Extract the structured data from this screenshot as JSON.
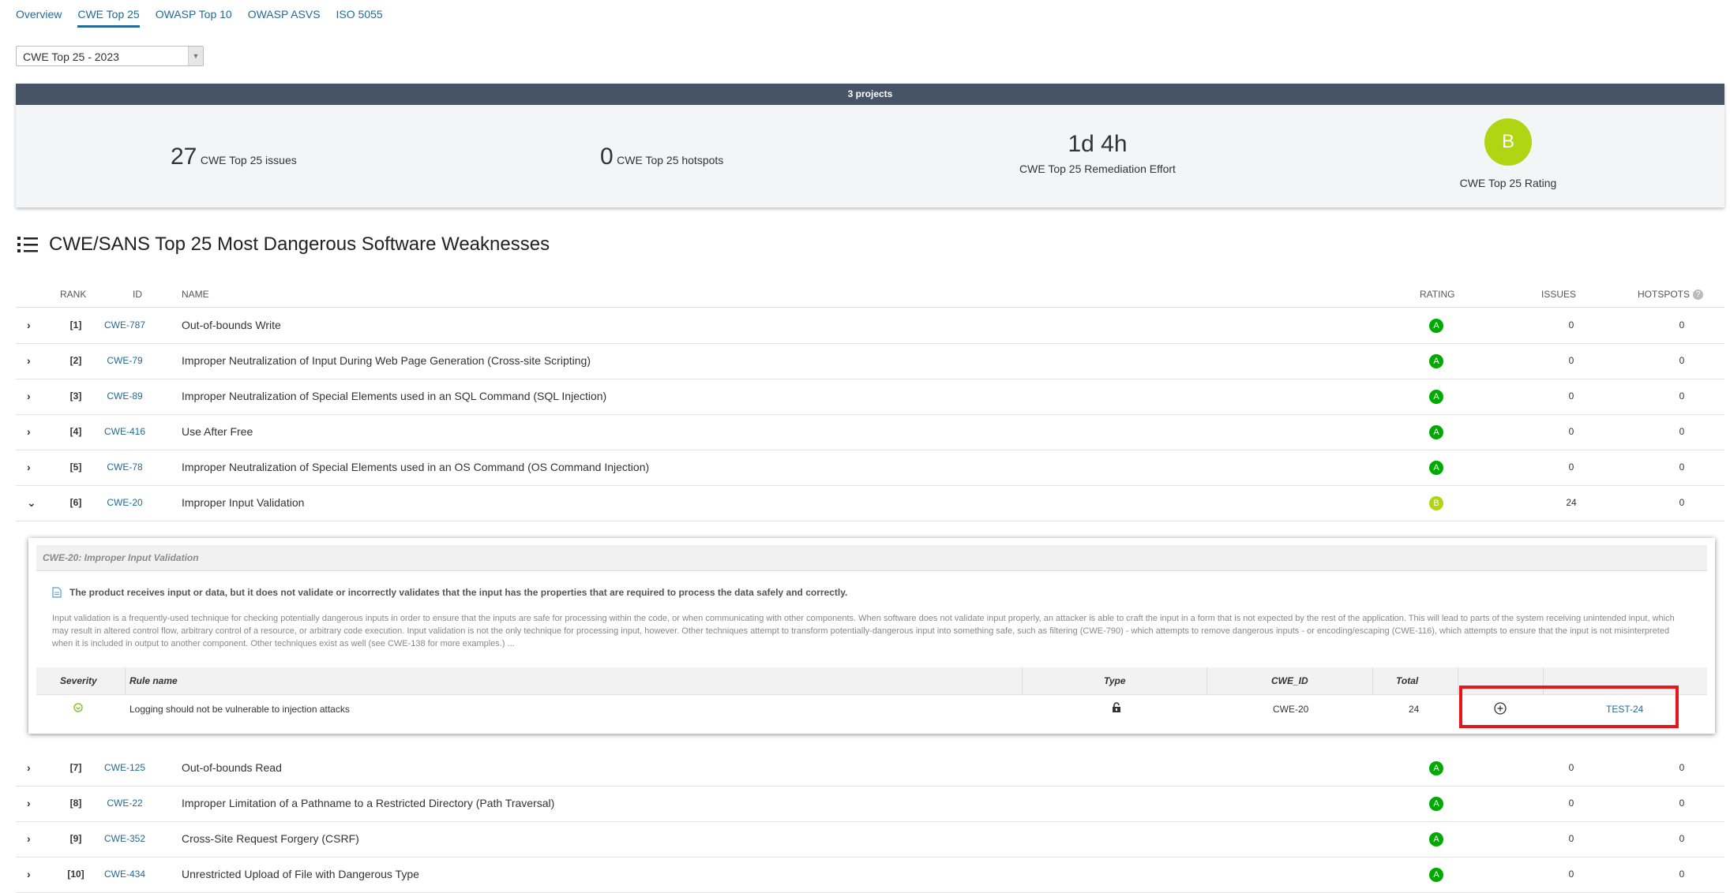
{
  "tabs": [
    "Overview",
    "CWE Top 25",
    "OWASP Top 10",
    "OWASP ASVS",
    "ISO 5055"
  ],
  "active_tab": "CWE Top 25",
  "select": {
    "value": "CWE Top 25 - 2023"
  },
  "summary": {
    "bar_label": "3 projects",
    "issues_value": "27",
    "issues_label": "CWE Top 25 issues",
    "hotspots_value": "0",
    "hotspots_label": "CWE Top 25 hotspots",
    "effort_value": "1d 4h",
    "effort_label": "CWE Top 25 Remediation Effort",
    "rating_value": "B",
    "rating_label": "CWE Top 25 Rating"
  },
  "section_title": "CWE/SANS Top 25 Most Dangerous Software Weaknesses",
  "table": {
    "headers": {
      "rank": "RANK",
      "id": "ID",
      "name": "NAME",
      "rating": "RATING",
      "issues": "ISSUES",
      "hotspots": "HOTSPOTS"
    },
    "rows_top": [
      {
        "chev": "›",
        "rank": "[1]",
        "id": "CWE-787",
        "name": "Out-of-bounds Write",
        "rating": "A",
        "issues": "0",
        "hotspots": "0"
      },
      {
        "chev": "›",
        "rank": "[2]",
        "id": "CWE-79",
        "name": "Improper Neutralization of Input During Web Page Generation (Cross-site Scripting)",
        "rating": "A",
        "issues": "0",
        "hotspots": "0"
      },
      {
        "chev": "›",
        "rank": "[3]",
        "id": "CWE-89",
        "name": "Improper Neutralization of Special Elements used in an SQL Command (SQL Injection)",
        "rating": "A",
        "issues": "0",
        "hotspots": "0"
      },
      {
        "chev": "›",
        "rank": "[4]",
        "id": "CWE-416",
        "name": "Use After Free",
        "rating": "A",
        "issues": "0",
        "hotspots": "0"
      },
      {
        "chev": "›",
        "rank": "[5]",
        "id": "CWE-78",
        "name": "Improper Neutralization of Special Elements used in an OS Command (OS Command Injection)",
        "rating": "A",
        "issues": "0",
        "hotspots": "0"
      },
      {
        "chev": "⌄",
        "rank": "[6]",
        "id": "CWE-20",
        "name": "Improper Input Validation",
        "rating": "B",
        "issues": "24",
        "hotspots": "0"
      }
    ],
    "rows_bottom": [
      {
        "chev": "›",
        "rank": "[7]",
        "id": "CWE-125",
        "name": "Out-of-bounds Read",
        "rating": "A",
        "issues": "0",
        "hotspots": "0"
      },
      {
        "chev": "›",
        "rank": "[8]",
        "id": "CWE-22",
        "name": "Improper Limitation of a Pathname to a Restricted Directory (Path Traversal)",
        "rating": "A",
        "issues": "0",
        "hotspots": "0"
      },
      {
        "chev": "›",
        "rank": "[9]",
        "id": "CWE-352",
        "name": "Cross-Site Request Forgery (CSRF)",
        "rating": "A",
        "issues": "0",
        "hotspots": "0"
      },
      {
        "chev": "›",
        "rank": "[10]",
        "id": "CWE-434",
        "name": "Unrestricted Upload of File with Dangerous Type",
        "rating": "A",
        "issues": "0",
        "hotspots": "0"
      }
    ]
  },
  "detail": {
    "title": "CWE-20: Improper Input Validation",
    "summary": "The product receives input or data, but it does not validate or incorrectly validates that the input has the properties that are required to process the data safely and correctly.",
    "description": "Input validation is a frequently-used technique for checking potentially dangerous inputs in order to ensure that the inputs are safe for processing within the code, or when communicating with other components. When software does not validate input properly, an attacker is able to craft the input in a form that is not expected by the rest of the application. This will lead to parts of the system receiving unintended input, which may result in altered control flow, arbitrary control of a resource, or arbitrary code execution. Input validation is not the only technique for processing input, however. Other techniques attempt to transform potentially-dangerous input into something safe, such as filtering (CWE-790) - which attempts to remove dangerous inputs - or encoding/escaping (CWE-116), which attempts to ensure that the input is not misinterpreted when it is included in output to another component. Other techniques exist as well (see CWE-138 for more examples.) ...",
    "headers": {
      "severity": "Severity",
      "rule": "Rule name",
      "type": "Type",
      "cwe": "CWE_ID",
      "total": "Total"
    },
    "rule": {
      "name": "Logging should not be vulnerable to injection attacks",
      "cwe": "CWE-20",
      "total": "24",
      "ticket": "TEST-24"
    }
  },
  "colors": {
    "rating_a": "#00aa00",
    "rating_b": "#b0d513",
    "link": "#236a97",
    "highlight": "#e8161b"
  }
}
